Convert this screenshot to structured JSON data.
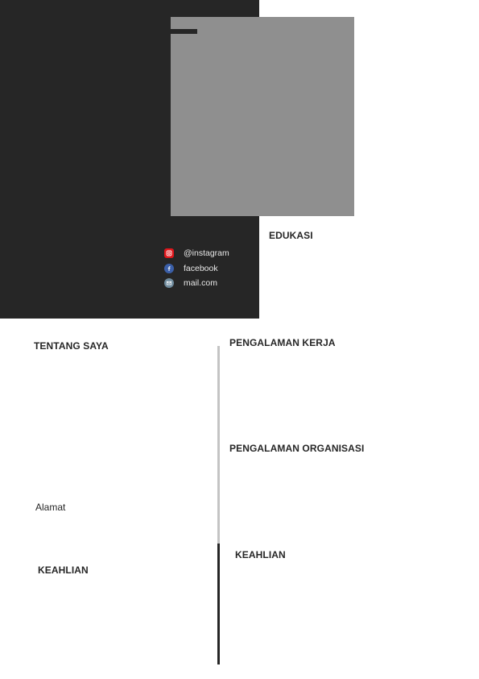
{
  "header": {
    "social": [
      {
        "icon": "instagram-icon",
        "label": "@instagram",
        "color": "#e0161b"
      },
      {
        "icon": "facebook-icon",
        "label": "facebook",
        "color": "#3b5fa8"
      },
      {
        "icon": "mail-icon",
        "label": "mail.com",
        "color": "#6e8a9c"
      }
    ]
  },
  "sections": {
    "edukasi": "EDUKASI",
    "tentang_saya": "TENTANG SAYA",
    "alamat": "Alamat",
    "keahlian_left": "KEAHLIAN",
    "pengalaman_kerja": "PENGALAMAN KERJA",
    "pengalaman_organisasi": "PENGALAMAN ORGANISASI",
    "keahlian_right": "KEAHLIAN"
  },
  "colors": {
    "panel": "#262626",
    "photo_placeholder": "#8f8f8f",
    "divider_light": "#c4c4c4"
  }
}
